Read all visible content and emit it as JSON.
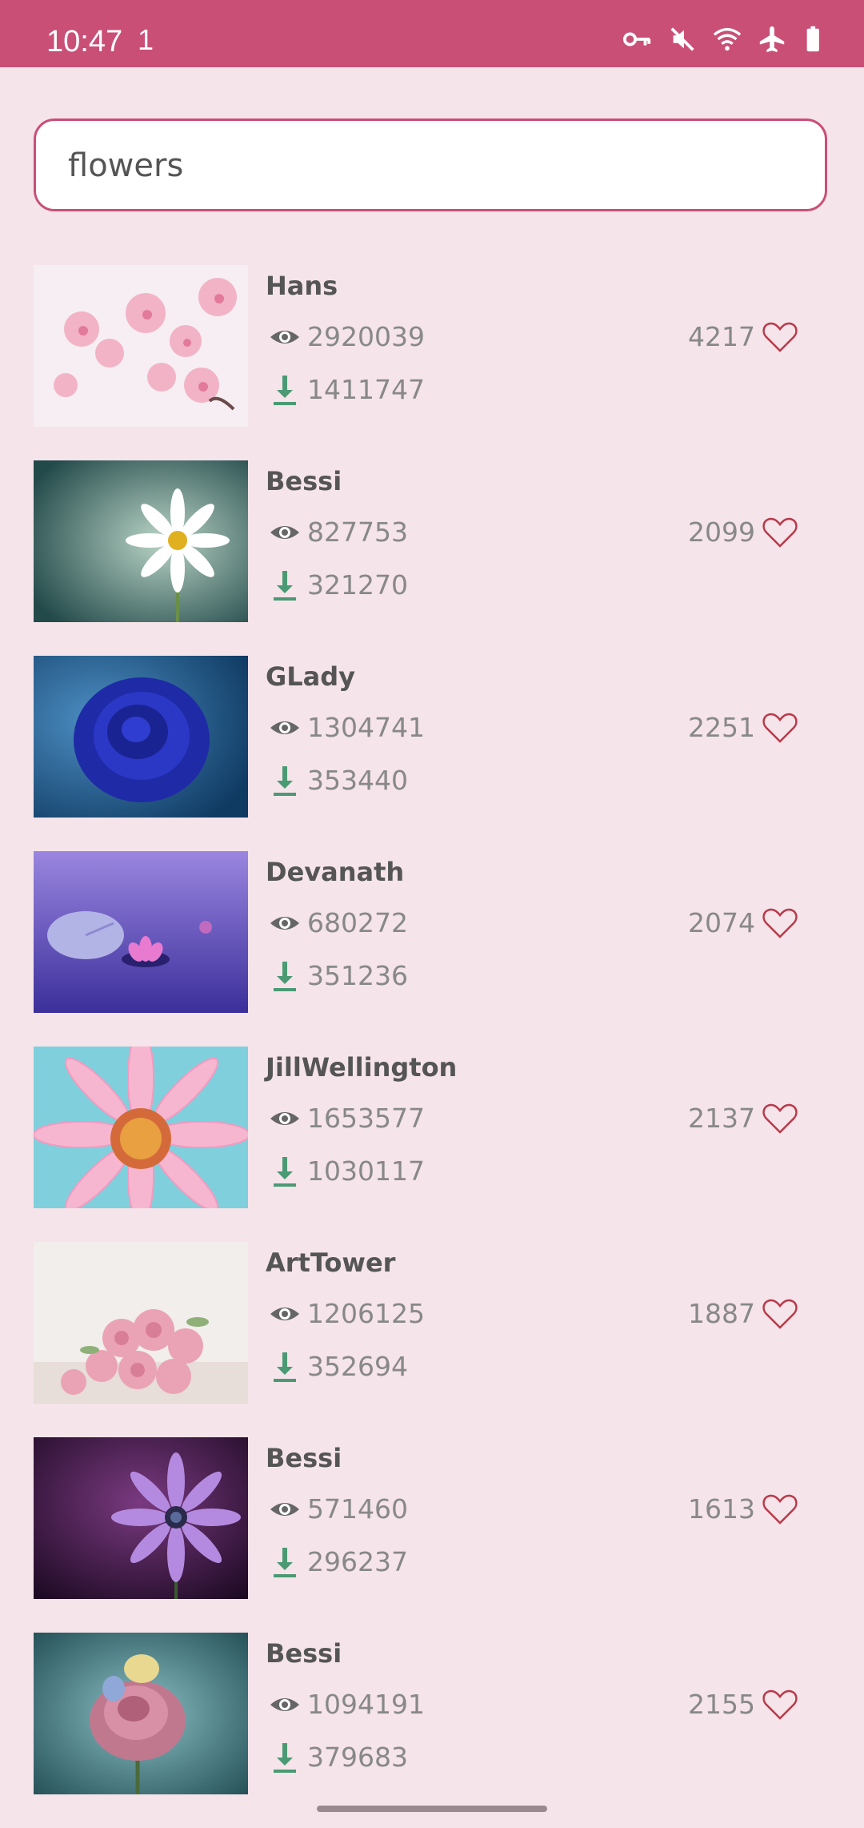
{
  "status_bar": {
    "time": "10:47",
    "extra": "1",
    "icons": [
      "vpn-key-icon",
      "mute-icon",
      "wifi-icon",
      "airplane-icon",
      "battery-icon"
    ]
  },
  "search": {
    "value": "flowers"
  },
  "results": [
    {
      "user": "Hans",
      "views": "2920039",
      "downloads": "1411747",
      "likes": "4217"
    },
    {
      "user": "Bessi",
      "views": "827753",
      "downloads": "321270",
      "likes": "2099"
    },
    {
      "user": "GLady",
      "views": "1304741",
      "downloads": "353440",
      "likes": "2251"
    },
    {
      "user": "Devanath",
      "views": "680272",
      "downloads": "351236",
      "likes": "2074"
    },
    {
      "user": "JillWellington",
      "views": "1653577",
      "downloads": "1030117",
      "likes": "2137"
    },
    {
      "user": "ArtTower",
      "views": "1206125",
      "downloads": "352694",
      "likes": "1887"
    },
    {
      "user": "Bessi",
      "views": "571460",
      "downloads": "296237",
      "likes": "1613"
    },
    {
      "user": "Bessi",
      "views": "1094191",
      "downloads": "379683",
      "likes": "2155"
    }
  ],
  "colors": {
    "accent": "#c94f77",
    "background": "#f5e4ea",
    "download_green": "#4a9a74",
    "heart": "#b83a4a"
  }
}
